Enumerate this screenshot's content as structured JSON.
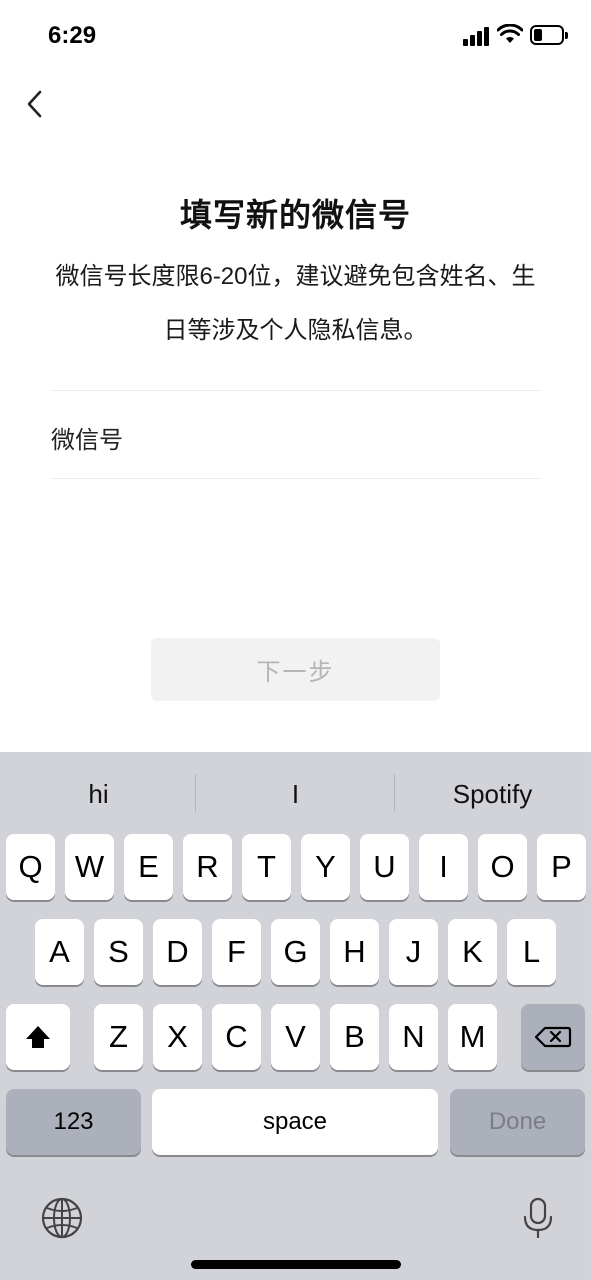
{
  "status_bar": {
    "time": "6:29",
    "battery_level": 0.3
  },
  "nav": {
    "back_icon": "chevron-left-icon"
  },
  "header": {
    "title": "填写新的微信号",
    "description": "微信号长度限6-20位，建议避免包含姓名、生日等涉及个人隐私信息。"
  },
  "form": {
    "field_label": "微信号",
    "field_value": ""
  },
  "actions": {
    "next_label": "下一步"
  },
  "keyboard": {
    "suggestions": [
      "hi",
      "I",
      "Spotify"
    ],
    "row1": [
      "Q",
      "W",
      "E",
      "R",
      "T",
      "Y",
      "U",
      "I",
      "O",
      "P"
    ],
    "row2": [
      "A",
      "S",
      "D",
      "F",
      "G",
      "H",
      "J",
      "K",
      "L"
    ],
    "row3": [
      "Z",
      "X",
      "C",
      "V",
      "B",
      "N",
      "M"
    ],
    "numbers_label": "123",
    "space_label": "space",
    "done_label": "Done",
    "shift_icon": "shift-icon",
    "delete_icon": "backspace-icon",
    "globe_icon": "globe-icon",
    "mic_icon": "microphone-icon"
  },
  "colors": {
    "keyboard_bg": "#d1d3d9",
    "special_key": "#abb0bb",
    "disabled_button_bg": "#f2f2f2",
    "disabled_button_text": "#b5b5b5"
  }
}
